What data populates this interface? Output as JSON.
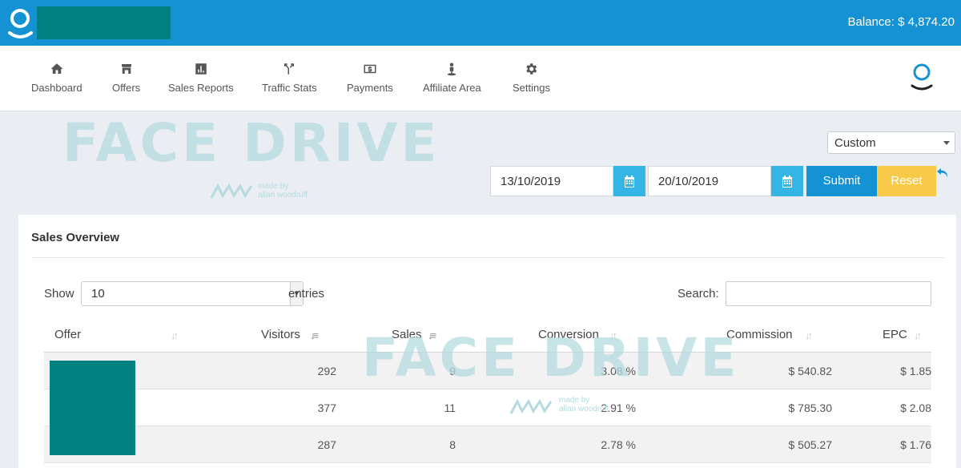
{
  "header": {
    "balance": "Balance: $ 4,874.20",
    "colors": {
      "topbar": "#1592d3",
      "redaction": "#008080"
    }
  },
  "nav": {
    "items": [
      {
        "label": "Dashboard",
        "icon": "home-icon"
      },
      {
        "label": "Offers",
        "icon": "store-icon"
      },
      {
        "label": "Sales Reports",
        "icon": "bar-chart-icon"
      },
      {
        "label": "Traffic Stats",
        "icon": "split-arrows-icon"
      },
      {
        "label": "Payments",
        "icon": "money-icon"
      },
      {
        "label": "Affiliate Area",
        "icon": "person-pin-icon"
      },
      {
        "label": "Settings",
        "icon": "gear-icon"
      }
    ]
  },
  "watermark": {
    "text": "FACE DRIVE",
    "credit_line1": "made by",
    "credit_line2": "allan woodruff"
  },
  "filters": {
    "range": "Custom",
    "start_date": "13/10/2019",
    "end_date": "20/10/2019",
    "submit": "Submit",
    "reset": "Reset"
  },
  "sales": {
    "title": "Sales Overview",
    "show_label": "Show",
    "page_length": "10",
    "entries_label": "entries",
    "search_label": "Search:",
    "search_value": "",
    "columns": [
      "Offer",
      "Visitors",
      "Sales",
      "Conversion",
      "Commission",
      "EPC"
    ],
    "rows": [
      {
        "visitors": "292",
        "sales": "9",
        "conversion": "3.08 %",
        "commission": "$ 540.82",
        "epc": "$ 1.85"
      },
      {
        "visitors": "377",
        "sales": "11",
        "conversion": "2.91 %",
        "commission": "$ 785.30",
        "epc": "$ 2.08"
      },
      {
        "visitors": "287",
        "sales": "8",
        "conversion": "2.78 %",
        "commission": "$ 505.27",
        "epc": "$ 1.76"
      }
    ]
  }
}
